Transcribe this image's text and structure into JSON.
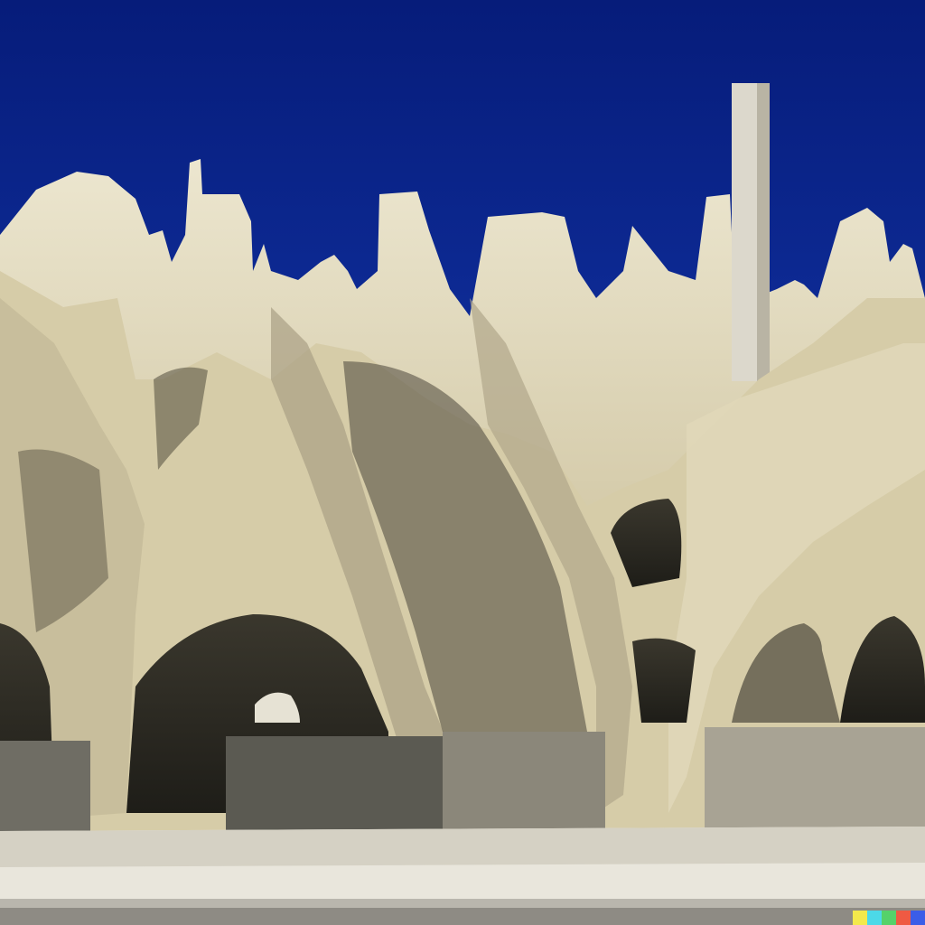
{
  "scene": {
    "subject": "sand-castle-rock-formation",
    "colors": {
      "sky_top": "#061c7a",
      "sky_bottom": "#1c46c8",
      "rock_light": "#e6dfc4",
      "rock_mid": "#c9bf9c",
      "rock_shadow": "#6f6a58",
      "cave_dark": "#2b2a24",
      "ground": "#e9e6dc"
    }
  },
  "watermark": {
    "colors": [
      "#f3e94b",
      "#4cd9e8",
      "#55d26a",
      "#ef5a43",
      "#3b5de8"
    ]
  }
}
